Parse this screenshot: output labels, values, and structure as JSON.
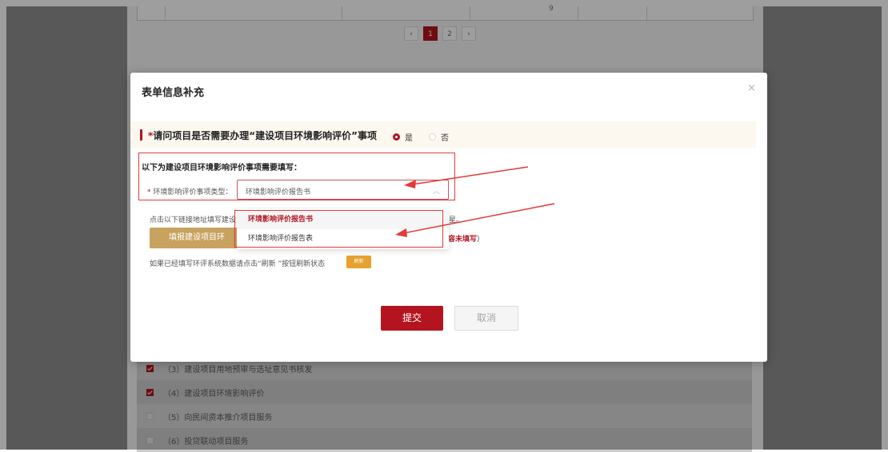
{
  "background": {
    "table": {
      "cell_value": "9"
    },
    "pagination": {
      "prev": "‹",
      "pages": [
        "1",
        "2"
      ],
      "next": "›",
      "current": "1"
    },
    "list": [
      {
        "label": "（3）建设项目用地预审与选址意见书核发",
        "checked": true
      },
      {
        "label": "（4）建设项目环境影响评价",
        "checked": true
      },
      {
        "label": "（5）向民间资本推介项目服务",
        "checked": false
      },
      {
        "label": "（6）投贷联动项目服务",
        "checked": false
      }
    ]
  },
  "modal": {
    "title": "表单信息补充",
    "close_icon": "×",
    "question": {
      "required_mark": "*",
      "text": "请问项目是否需要办理“建设项目环境影响评价”事项",
      "options": [
        "是",
        "否"
      ],
      "selected": "是"
    },
    "section": {
      "title": "以下为建设项目环境影响评价事项需要填写：",
      "field": {
        "required_mark": "*",
        "label": "环境影响评价事项类型：",
        "value": "环境影响评价报告书",
        "chevron": "︿"
      }
    },
    "link_hint": "点击以下链接地址填写建设",
    "link_hint_tail": "星。",
    "fill_button": "填报建设项目环",
    "warn_text": "容未填写",
    "warn_paren": "）",
    "refresh_hint": "如果已经填写环评系统数据请点击“刷新 ”按钮刷新状态",
    "refresh_button": "刷新",
    "submit_button": "提交",
    "cancel_button": "取消"
  },
  "dropdown": {
    "options": [
      "环境影响评价报告书",
      "环境影响评价报告表"
    ],
    "selected": "环境影响评价报告书"
  },
  "colors": {
    "brand_red": "#b3141f",
    "annotation_red": "#e23a3a",
    "gold_button": "#c8a25f",
    "refresh_orange": "#e7a12f"
  }
}
